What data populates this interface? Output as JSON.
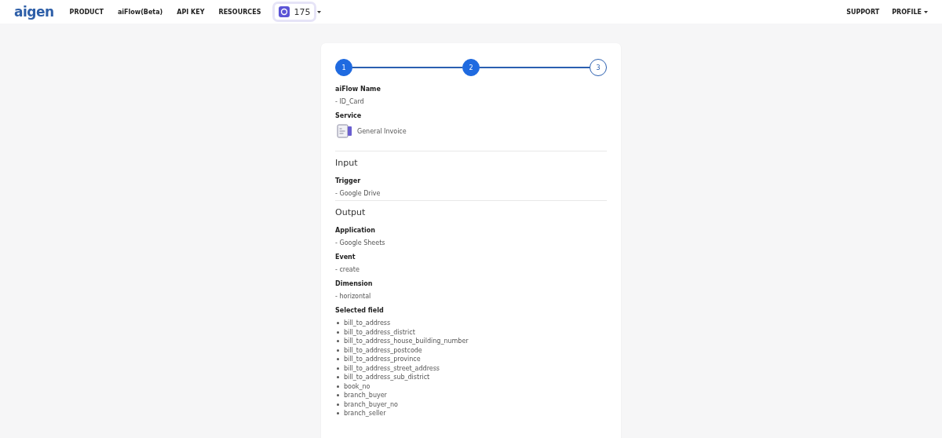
{
  "navbar": {
    "logo": "aigen",
    "menu": [
      "PRODUCT",
      "aiFlow(Beta)",
      "API KEY",
      "RESOURCES"
    ],
    "credits": "175",
    "right_menu": [
      {
        "label": "SUPPORT",
        "dropdown": false
      },
      {
        "label": "PROFILE",
        "dropdown": true
      }
    ]
  },
  "steps": [
    {
      "label": "1",
      "active": true
    },
    {
      "label": "2",
      "active": true
    },
    {
      "label": "3",
      "active": false
    }
  ],
  "summary": {
    "sections": [
      {
        "items": [
          {
            "label": "aiFlow Name",
            "kind": "text",
            "value": "- ID_Card"
          },
          {
            "label": "Service",
            "kind": "service",
            "value": "General Invoice"
          }
        ]
      },
      {
        "heading": "Input",
        "items": [
          {
            "label": "Trigger",
            "kind": "text",
            "value": "- Google Drive"
          }
        ]
      },
      {
        "heading": "Output",
        "items": [
          {
            "label": "Application",
            "kind": "text",
            "value": "- Google Sheets"
          },
          {
            "label": "Event",
            "kind": "text",
            "value": "- create"
          },
          {
            "label": "Dimension",
            "kind": "text",
            "value": "- horizontal"
          },
          {
            "label": "Selected field",
            "kind": "list",
            "values": [
              "bill_to_address",
              "bill_to_address_district",
              "bill_to_address_house_building_number",
              "bill_to_address_postcode",
              "bill_to_address_province",
              "bill_to_address_street_address",
              "bill_to_address_sub_district",
              "book_no",
              "branch_buyer",
              "branch_buyer_no",
              "branch_seller"
            ]
          }
        ]
      }
    ]
  }
}
